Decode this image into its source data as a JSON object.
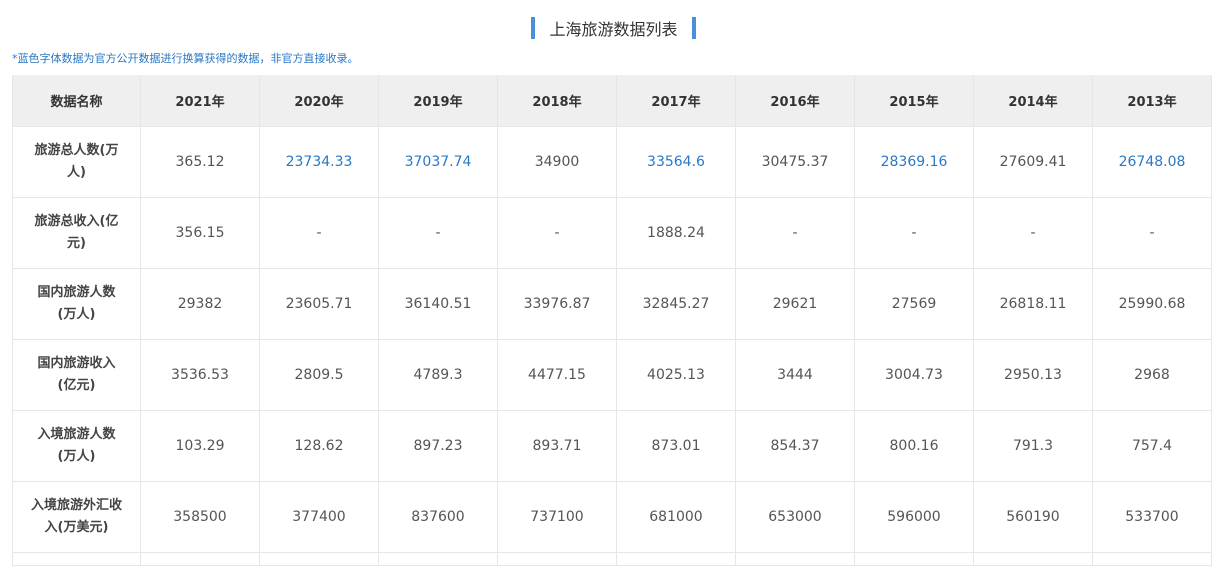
{
  "title": "上海旅游数据列表",
  "note": "*蓝色字体数据为官方公开数据进行换算获得的数据，非官方直接收录。",
  "colors": {
    "accent": "#4a90d9",
    "converted_value": "#2b78c5"
  },
  "table": {
    "headers": [
      "数据名称",
      "2021年",
      "2020年",
      "2019年",
      "2018年",
      "2017年",
      "2016年",
      "2015年",
      "2014年",
      "2013年"
    ],
    "rows": [
      {
        "name": "旅游总人数(万人)",
        "values": [
          "365.12",
          "23734.33",
          "37037.74",
          "34900",
          "33564.6",
          "30475.37",
          "28369.16",
          "27609.41",
          "26748.08"
        ],
        "blue": [
          false,
          true,
          true,
          false,
          true,
          false,
          true,
          false,
          true
        ]
      },
      {
        "name": "旅游总收入(亿元)",
        "values": [
          "356.15",
          "-",
          "-",
          "-",
          "1888.24",
          "-",
          "-",
          "-",
          "-"
        ],
        "blue": [
          false,
          false,
          false,
          false,
          false,
          false,
          false,
          false,
          false
        ]
      },
      {
        "name": "国内旅游人数(万人)",
        "values": [
          "29382",
          "23605.71",
          "36140.51",
          "33976.87",
          "32845.27",
          "29621",
          "27569",
          "26818.11",
          "25990.68"
        ],
        "blue": [
          false,
          false,
          false,
          false,
          false,
          false,
          false,
          false,
          false
        ]
      },
      {
        "name": "国内旅游收入(亿元)",
        "values": [
          "3536.53",
          "2809.5",
          "4789.3",
          "4477.15",
          "4025.13",
          "3444",
          "3004.73",
          "2950.13",
          "2968"
        ],
        "blue": [
          false,
          false,
          false,
          false,
          false,
          false,
          false,
          false,
          false
        ]
      },
      {
        "name": "入境旅游人数(万人)",
        "values": [
          "103.29",
          "128.62",
          "897.23",
          "893.71",
          "873.01",
          "854.37",
          "800.16",
          "791.3",
          "757.4"
        ],
        "blue": [
          false,
          false,
          false,
          false,
          false,
          false,
          false,
          false,
          false
        ]
      },
      {
        "name": "入境旅游外汇收入(万美元)",
        "values": [
          "358500",
          "377400",
          "837600",
          "737100",
          "681000",
          "653000",
          "596000",
          "560190",
          "533700"
        ],
        "blue": [
          false,
          false,
          false,
          false,
          false,
          false,
          false,
          false,
          false
        ]
      }
    ]
  }
}
